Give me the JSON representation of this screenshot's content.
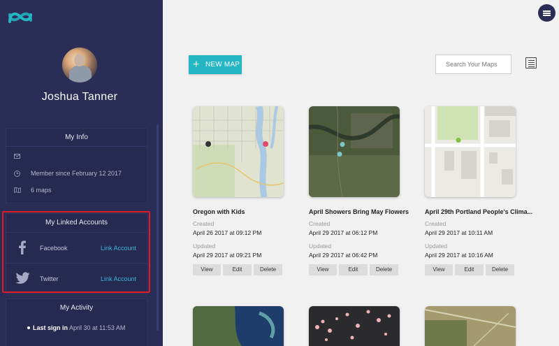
{
  "user": {
    "name": "Joshua Tanner"
  },
  "my_info": {
    "title": "My Info",
    "email": "",
    "member_since": "Member since February 12 2017",
    "maps_count": "6 maps"
  },
  "linked_accounts": {
    "title": "My Linked Accounts",
    "accounts": [
      {
        "name": "Facebook",
        "action": "Link Account"
      },
      {
        "name": "Twitter",
        "action": "Link Account"
      }
    ]
  },
  "activity": {
    "title": "My Activity",
    "last_sign_in_label": "Last sign in",
    "last_sign_in_value": "April 30 at 11:53 AM"
  },
  "toolbar": {
    "new_map_label": "NEW MAP",
    "search_placeholder": "Search Your Maps"
  },
  "labels": {
    "created": "Created",
    "updated": "Updated",
    "view": "View",
    "edit": "Edit",
    "delete": "Delete"
  },
  "maps": [
    {
      "title": "Oregon with Kids",
      "created": "April 26 2017 at 09:12 PM",
      "updated": "April 29 2017 at 09:21 PM"
    },
    {
      "title": "April Showers Bring May Flowers",
      "created": "April 29 2017 at 06:12 PM",
      "updated": "April 29 2017 at 06:42 PM"
    },
    {
      "title": "April 29th Portland People's Clima...",
      "created": "April 29 2017 at 10:11 AM",
      "updated": "April 29 2017 at 10:16 AM"
    }
  ],
  "colors": {
    "sidebar": "#2a2d56",
    "accent": "#25b6c4",
    "link": "#3fb6d6",
    "highlight": "#e01b24"
  }
}
